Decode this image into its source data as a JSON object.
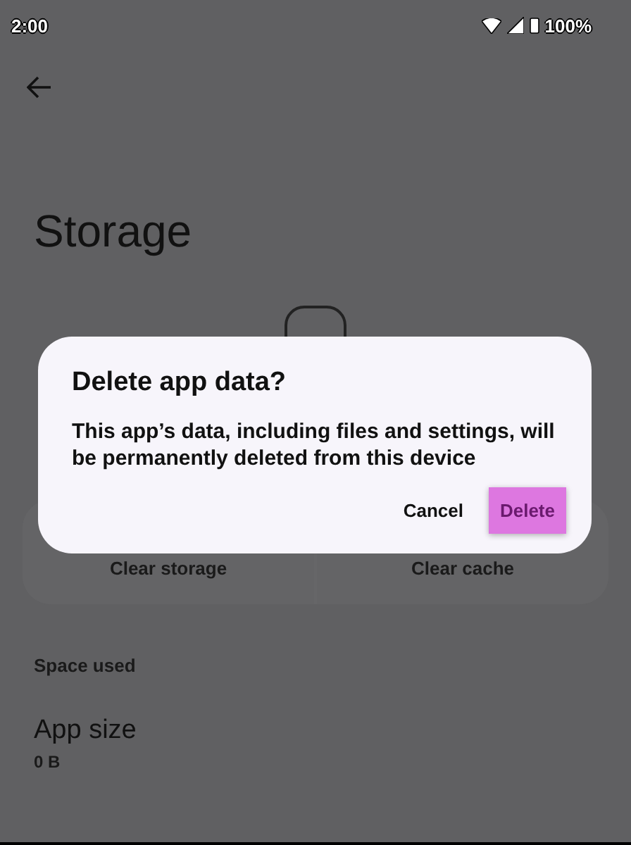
{
  "status_bar": {
    "time": "2:00",
    "battery": "100%"
  },
  "page": {
    "title": "Storage"
  },
  "actions": [
    {
      "label": "Clear storage"
    },
    {
      "label": "Clear cache"
    }
  ],
  "sections": [
    {
      "kind": "header",
      "text": "Space used"
    },
    {
      "kind": "item",
      "title": "App size",
      "value": "0 B"
    }
  ],
  "dialog": {
    "title": "Delete app data?",
    "message": "This app’s data, including files and settings, will be permanently deleted from this device",
    "buttons": [
      {
        "label": "Cancel",
        "focused": false
      },
      {
        "label": "Delete",
        "focused": true
      }
    ]
  }
}
